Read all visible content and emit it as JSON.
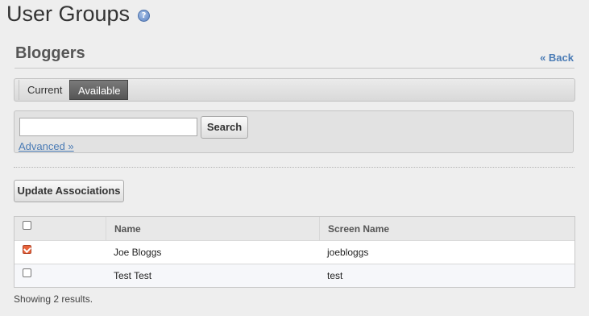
{
  "page": {
    "title": "User Groups",
    "help_icon": "help-icon"
  },
  "section": {
    "title": "Bloggers",
    "back_link": "« Back"
  },
  "tabs": [
    {
      "label": "Current",
      "active": false
    },
    {
      "label": "Available",
      "active": true
    }
  ],
  "search": {
    "value": "",
    "placeholder": "",
    "button_label": "Search",
    "advanced_link": "Advanced »"
  },
  "actions": {
    "update_label": "Update Associations"
  },
  "table": {
    "columns": [
      "",
      "Name",
      "Screen Name"
    ],
    "rows": [
      {
        "checked": true,
        "name": "Joe Bloggs",
        "screen_name": "joebloggs"
      },
      {
        "checked": false,
        "name": "Test Test",
        "screen_name": "test"
      }
    ]
  },
  "footer": {
    "results_text": "Showing 2 results."
  },
  "colors": {
    "accent": "#4a7bb5",
    "checkbox_checked": "#e8643c",
    "active_tab": "#555555"
  }
}
